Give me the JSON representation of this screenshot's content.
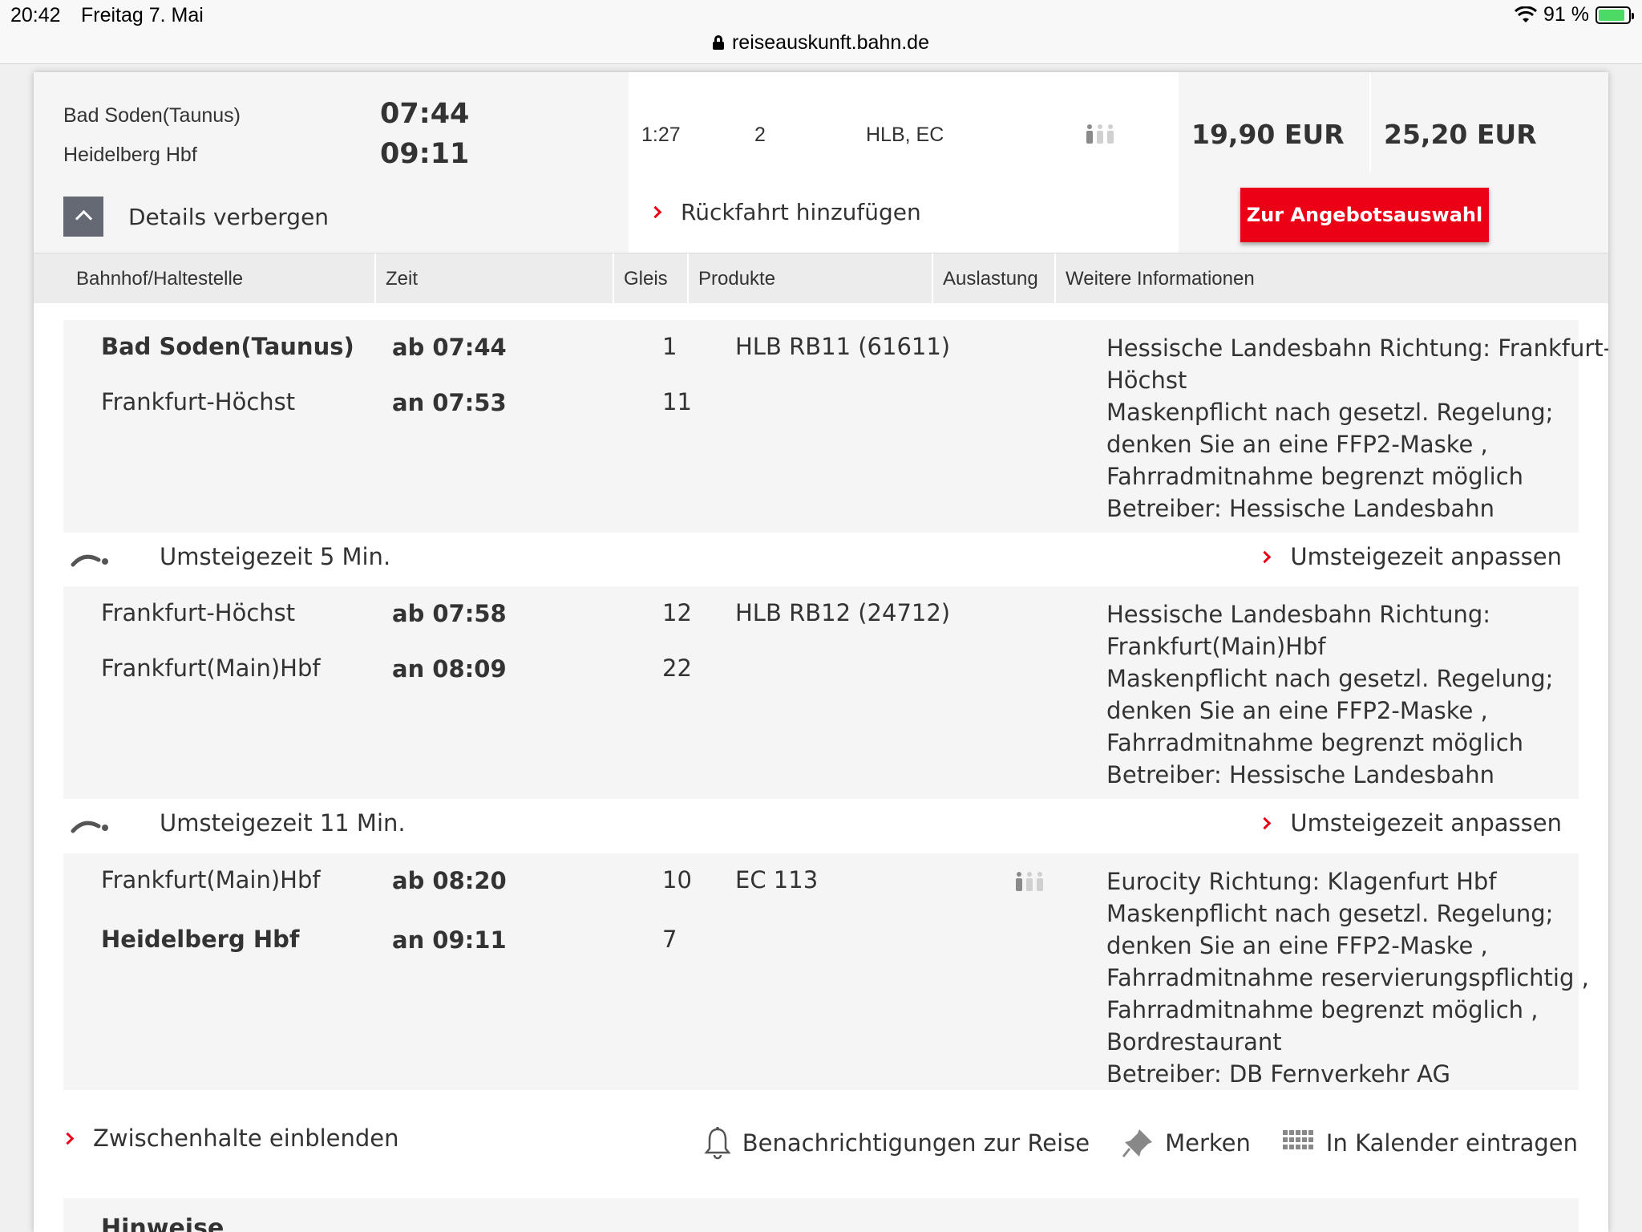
{
  "status_bar": {
    "time": "20:42",
    "date": "Freitag 7. Mai",
    "battery": "91 %",
    "url": "reiseauskunft.bahn.de"
  },
  "summary": {
    "from": "Bad Soden(Taunus)",
    "to": "Heidelberg Hbf",
    "dep": "07:44",
    "arr": "09:11",
    "duration": "1:27",
    "changes": "2",
    "products": "HLB, EC",
    "details_label": "Details verbergen",
    "return_label": "Rückfahrt hinzufügen",
    "price1": "19,90 EUR",
    "price2": "25,20 EUR",
    "cta_label": "Zur Angebotsauswahl"
  },
  "table_headers": {
    "station": "Bahnhof/Haltestelle",
    "time": "Zeit",
    "platform": "Gleis",
    "products": "Produkte",
    "occupancy": "Auslastung",
    "info": "Weitere Informationen"
  },
  "legs": [
    {
      "from": "Bad Soden(Taunus)",
      "from_time": "ab 07:44",
      "from_platform": "1",
      "to": "Frankfurt-Höchst",
      "to_time": "an 07:53",
      "to_platform": "11",
      "product": "HLB RB11 (61611)",
      "info": [
        "Hessische Landesbahn Richtung: Frankfurt-",
        "Höchst",
        "Maskenpflicht nach gesetzl. Regelung;",
        "denken Sie an eine FFP2-Maske ,",
        "Fahrradmitnahme begrenzt möglich",
        "Betreiber: Hessische Landesbahn"
      ]
    },
    {
      "from": "Frankfurt-Höchst",
      "from_time": "ab 07:58",
      "from_platform": "12",
      "to": "Frankfurt(Main)Hbf",
      "to_time": "an 08:09",
      "to_platform": "22",
      "product": "HLB RB12 (24712)",
      "info": [
        "Hessische Landesbahn Richtung:",
        "Frankfurt(Main)Hbf",
        "Maskenpflicht nach gesetzl. Regelung;",
        "denken Sie an eine FFP2-Maske ,",
        "Fahrradmitnahme begrenzt möglich",
        "Betreiber: Hessische Landesbahn"
      ]
    },
    {
      "from": "Frankfurt(Main)Hbf",
      "from_time": "ab 08:20",
      "from_platform": "10",
      "to": "Heidelberg Hbf",
      "to_time": "an 09:11",
      "to_platform": "7",
      "product": "EC 113",
      "info": [
        "Eurocity Richtung: Klagenfurt Hbf",
        "Maskenpflicht nach gesetzl. Regelung;",
        "denken Sie an eine FFP2-Maske ,",
        "Fahrradmitnahme reservierungspflichtig ,",
        "Fahrradmitnahme begrenzt möglich ,",
        "Bordrestaurant",
        "Betreiber: DB Fernverkehr AG"
      ]
    }
  ],
  "transfers": [
    {
      "label": "Umsteigezeit 5 Min.",
      "adjust": "Umsteigezeit anpassen"
    },
    {
      "label": "Umsteigezeit 11 Min.",
      "adjust": "Umsteigezeit anpassen"
    }
  ],
  "bottom": {
    "stops_label": "Zwischenhalte einblenden",
    "notify_label": "Benachrichtigungen zur Reise",
    "save_label": "Merken",
    "calendar_label": "In Kalender eintragen",
    "hints_title": "Hinweise"
  },
  "colors": {
    "accent": "#ec0016",
    "panel": "#f5f5f5",
    "header": "#ececec"
  }
}
